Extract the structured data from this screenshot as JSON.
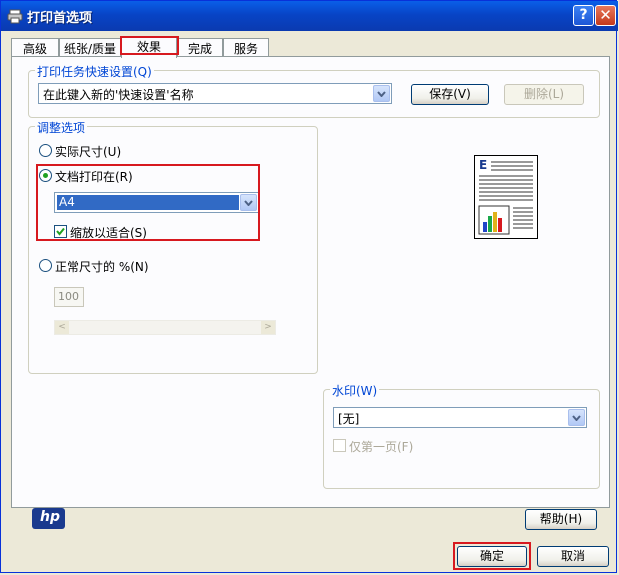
{
  "window": {
    "title": "打印首选项",
    "help_btn": "?",
    "close_btn": "✕"
  },
  "tabs": [
    {
      "label": "高级"
    },
    {
      "label": "纸张/质量"
    },
    {
      "label": "效果"
    },
    {
      "label": "完成"
    },
    {
      "label": "服务"
    }
  ],
  "quick_settings": {
    "group_label": "打印任务快速设置(Q)",
    "combo_value": "在此键入新的'快速设置'名称",
    "save_btn": "保存(V)",
    "delete_btn": "删除(L)"
  },
  "adjust": {
    "group_label": "调整选项",
    "actual_size": "实际尺寸(U)",
    "print_on": "文档打印在(R)",
    "paper_value": "A4",
    "scale_fit": "缩放以适合(S)",
    "normal_percent": "正常尺寸的 %(N)",
    "percent_value": "100",
    "slider_left": "<",
    "slider_right": ">"
  },
  "preview": {
    "letter": "E"
  },
  "watermark": {
    "group_label": "水印(W)",
    "combo_value": "[无]",
    "first_page_only": "仅第一页(F)"
  },
  "logo_text": "hp",
  "help_button": "帮助(H)",
  "ok_button": "确定",
  "cancel_button": "取消",
  "colors": {
    "title_bar": "#0a5fe8",
    "group_label": "#0046d5",
    "highlight": "#d7191f",
    "selection": "#316ac5"
  }
}
